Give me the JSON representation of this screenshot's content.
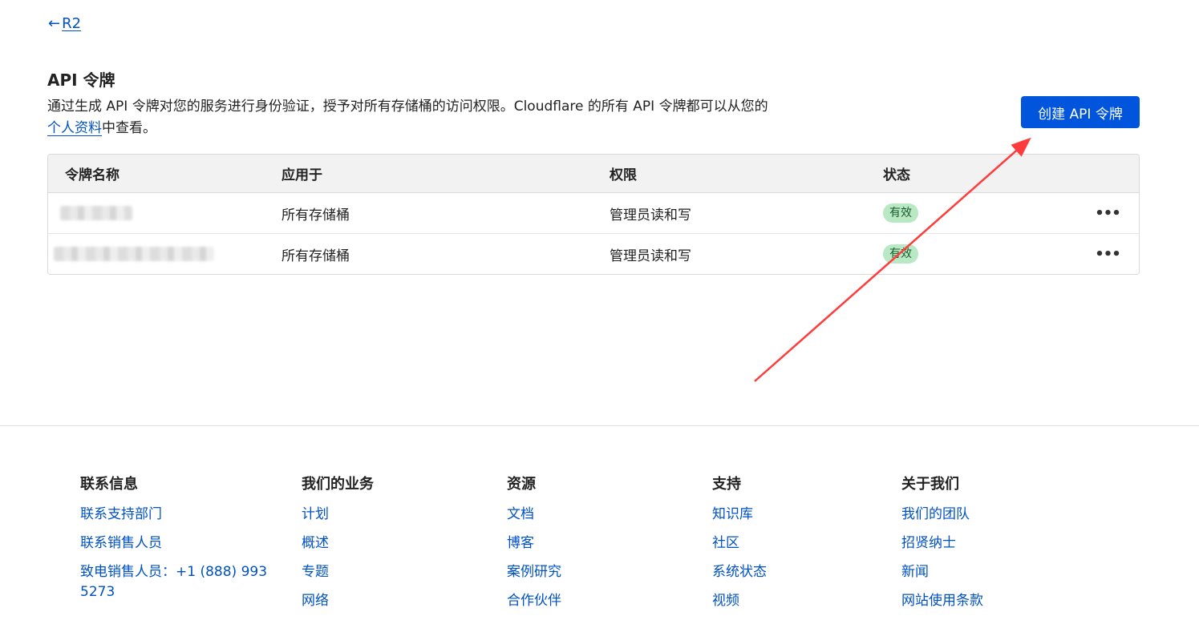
{
  "breadcrumb": {
    "arrow": "←",
    "label": "R2"
  },
  "header": {
    "title": "API 令牌",
    "description_prefix": "通过生成 API 令牌对您的服务进行身份验证，授予对所有存储桶的访问权限。Cloudflare 的所有 API 令牌都可以从您的",
    "profile_link": "个人资料",
    "description_suffix": "中查看。",
    "create_button": "创建 API 令牌"
  },
  "table": {
    "columns": [
      "令牌名称",
      "应用于",
      "权限",
      "状态"
    ],
    "rows": [
      {
        "applies_to": "所有存储桶",
        "permission": "管理员读和写",
        "status": "有效",
        "more": "•••"
      },
      {
        "applies_to": "所有存储桶",
        "permission": "管理员读和写",
        "status": "有效",
        "more": "•••"
      }
    ]
  },
  "annotation": {
    "color": "#ff3b3b"
  },
  "footer": {
    "columns": [
      {
        "title": "联系信息",
        "links": [
          "联系支持部门",
          "联系销售人员",
          "致电销售人员：+1 (888) 993 5273"
        ]
      },
      {
        "title": "我们的业务",
        "links": [
          "计划",
          "概述",
          "专题",
          "网络"
        ]
      },
      {
        "title": "资源",
        "links": [
          "文档",
          "博客",
          "案例研究",
          "合作伙伴"
        ]
      },
      {
        "title": "支持",
        "links": [
          "知识库",
          "社区",
          "系统状态",
          "视频"
        ]
      },
      {
        "title": "关于我们",
        "links": [
          "我们的团队",
          "招贤纳士",
          "新闻",
          "网站使用条款"
        ]
      }
    ]
  },
  "colors": {
    "accent": "#0055dc",
    "link": "#0051c3",
    "badge_bg": "#b8e8c4"
  }
}
